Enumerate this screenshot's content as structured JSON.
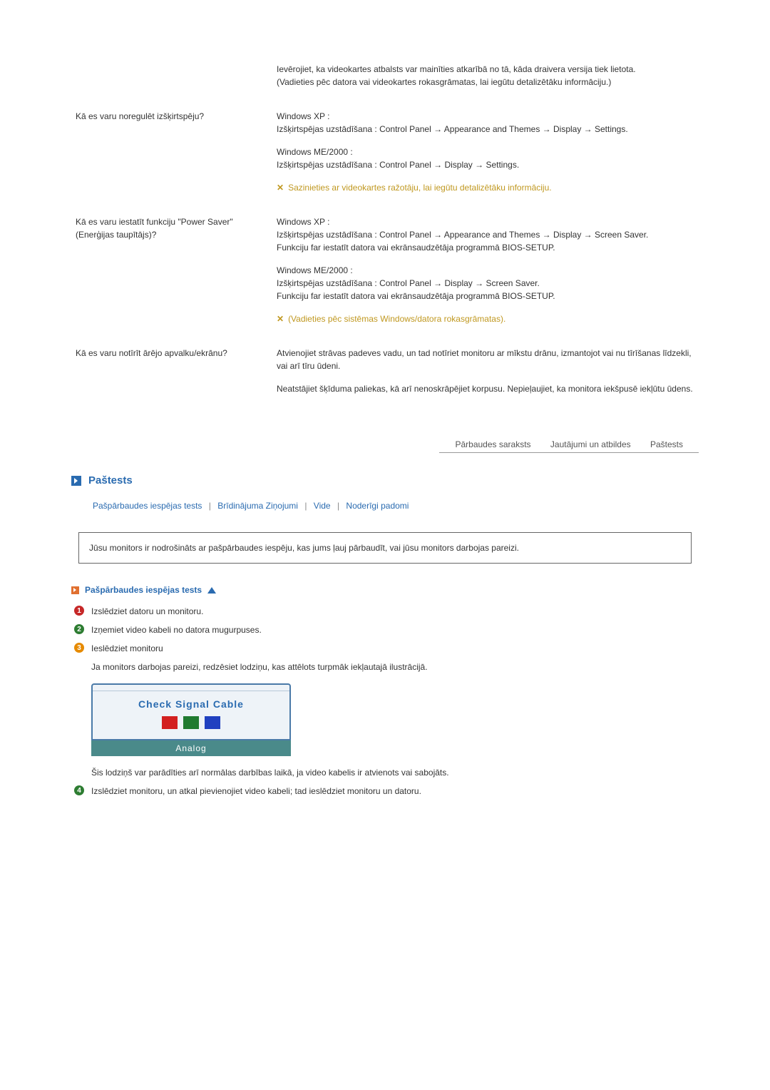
{
  "qa": [
    {
      "q": "",
      "blocks": [
        {
          "text": "Ievērojiet, ka videokartes atbalsts var mainīties atkarībā no tā, kāda draivera versija tiek lietota.\n(Vadieties pēc datora vai videokartes rokasgrāmatas, lai iegūtu detalizētāku informāciju.)"
        }
      ]
    },
    {
      "q": "Kā es varu noregulēt izšķirtspēju?",
      "blocks": [
        {
          "text": "Windows XP :\nIzšķirtspējas uzstādīšana : Control Panel → Appearance and Themes → Display → Settings."
        },
        {
          "text": "Windows ME/2000 :\nIzšķirtspējas uzstādīšana : Control Panel → Display → Settings."
        },
        {
          "note": "Sazinieties ar videokartes ražotāju, lai iegūtu detalizētāku informāciju."
        }
      ]
    },
    {
      "q": "Kā es varu iestatīt funkciju \"Power Saver\" (Enerģijas taupītājs)?",
      "blocks": [
        {
          "text": "Windows XP :\nIzšķirtspējas uzstādīšana : Control Panel → Appearance and Themes → Display → Screen Saver.\nFunkciju far iestatīt datora vai ekrānsaudzētāja programmā BIOS-SETUP."
        },
        {
          "text": "Windows ME/2000 :\nIzšķirtspējas uzstādīšana : Control Panel → Display → Screen Saver.\nFunkciju far iestatīt datora vai ekrānsaudzētāja programmā BIOS-SETUP."
        },
        {
          "note": "(Vadieties pēc sistēmas Windows/datora rokasgrāmatas)."
        }
      ]
    },
    {
      "q": "Kā es varu notīrīt ārējo apvalku/ekrānu?",
      "blocks": [
        {
          "text": "Atvienojiet strāvas padeves vadu, un tad notīriet monitoru ar mīkstu drānu, izmantojot vai nu tīrīšanas līdzekli, vai arī tīru ūdeni."
        },
        {
          "text": "Neatstājiet šķīduma paliekas, kā arī nenoskrāpējiet korpusu. Nepieļaujiet, ka monitora iekšpusē iekļūtu ūdens."
        }
      ]
    }
  ],
  "tabs": [
    "Pārbaudes saraksts",
    "Jautājumi un atbildes",
    "Paštests"
  ],
  "section_title": "Paštests",
  "subnav": [
    "Pašpārbaudes iespējas tests",
    "Brīdinājuma Ziņojumi",
    "Vide",
    "Noderīgi padomi"
  ],
  "info_box": "Jūsu monitors ir nodrošināts ar pašpārbaudes iespēju, kas jums ļauj pārbaudīt, vai jūsu monitors darbojas pareizi.",
  "subhead": "Pašpārbaudes iespējas tests",
  "steps": {
    "s1": "Izslēdziet datoru un monitoru.",
    "s2": "Izņemiet video kabeli no datora mugurpuses.",
    "s3": "Ieslēdziet monitoru",
    "s3b": "Ja monitors darbojas pareizi, redzēsiet lodziņu, kas attēlots turpmāk iekļautajā ilustrācijā.",
    "s3c": "Šis lodziņš var parādīties arī normālas darbības laikā, ja video kabelis ir atvienots vai sabojāts.",
    "s4": "Izslēdziet monitoru, un atkal pievienojiet video kabeli; tad ieslēdziet monitoru un datoru."
  },
  "osd": {
    "title": "Check Signal Cable",
    "bar": "Analog"
  }
}
